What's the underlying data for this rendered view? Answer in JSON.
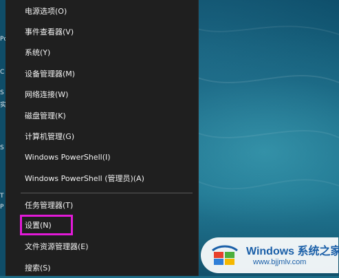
{
  "menu": {
    "items": [
      {
        "label": "电源选项(O)"
      },
      {
        "label": "事件查看器(V)"
      },
      {
        "label": "系统(Y)"
      },
      {
        "label": "设备管理器(M)"
      },
      {
        "label": "网络连接(W)"
      },
      {
        "label": "磁盘管理(K)"
      },
      {
        "label": "计算机管理(G)"
      },
      {
        "label": "Windows PowerShell(I)"
      },
      {
        "label": "Windows PowerShell (管理员)(A)"
      },
      {
        "label": "任务管理器(T)"
      },
      {
        "label": "设置(N)"
      },
      {
        "label": "文件资源管理器(E)"
      },
      {
        "label": "搜索(S)"
      }
    ],
    "highlighted_item": "设置(N)",
    "highlight_color": "#e21ad8"
  },
  "left_edge": {
    "chars": [
      "Pc",
      "C",
      "S",
      "实",
      "S",
      "T",
      "P"
    ]
  },
  "watermark": {
    "title": "Windows 系统之家",
    "url": "www.bjjmlv.com",
    "logo": "windows-logo-icon"
  },
  "colors": {
    "menu_bg": "#1f1f1f",
    "menu_text": "#f2f2f2",
    "desktop": "#1c6b86",
    "watermark_text": "#1a5fa8"
  }
}
